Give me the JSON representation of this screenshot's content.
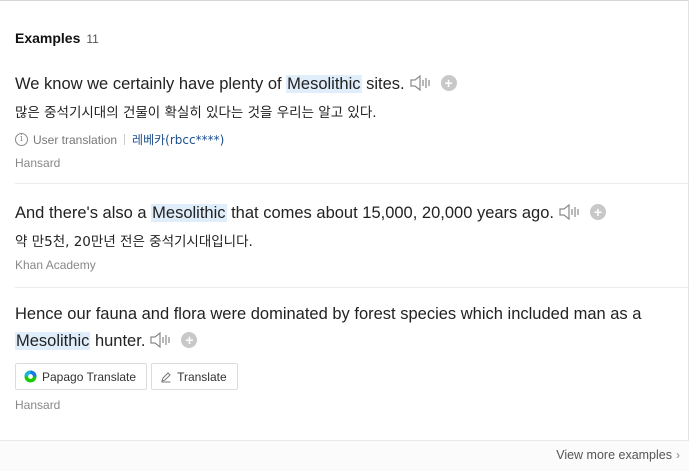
{
  "section": {
    "title": "Examples",
    "count": "11"
  },
  "examples": [
    {
      "before": "We know we certainly have plenty of ",
      "highlight": "Mesolithic",
      "after": " sites.",
      "translation": "많은 중석기시대의 건물이 확실히 있다는 것을 우리는 알고 있다.",
      "translation_type": "User translation",
      "translator": "레베카(rbcc****)",
      "source": "Hansard"
    },
    {
      "before": "And there's also a ",
      "highlight": "Mesolithic",
      "after": " that comes about 15,000, 20,000 years ago.",
      "translation": "약 만5천, 20만년 전은 중석기시대입니다.",
      "source": "Khan Academy"
    },
    {
      "before": "Hence our fauna and flora were dominated by forest species which included man as a ",
      "highlight": "Mesolithic",
      "after": " hunter.",
      "papago_label": "Papago Translate",
      "translate_label": "Translate",
      "source": "Hansard"
    }
  ],
  "footer": {
    "more_label": "View more examples",
    "chevron": "›"
  },
  "icons": {
    "plus": "+",
    "info": "i"
  },
  "colors": {
    "highlight": "#dfeefa",
    "link": "#1b4e8c"
  }
}
